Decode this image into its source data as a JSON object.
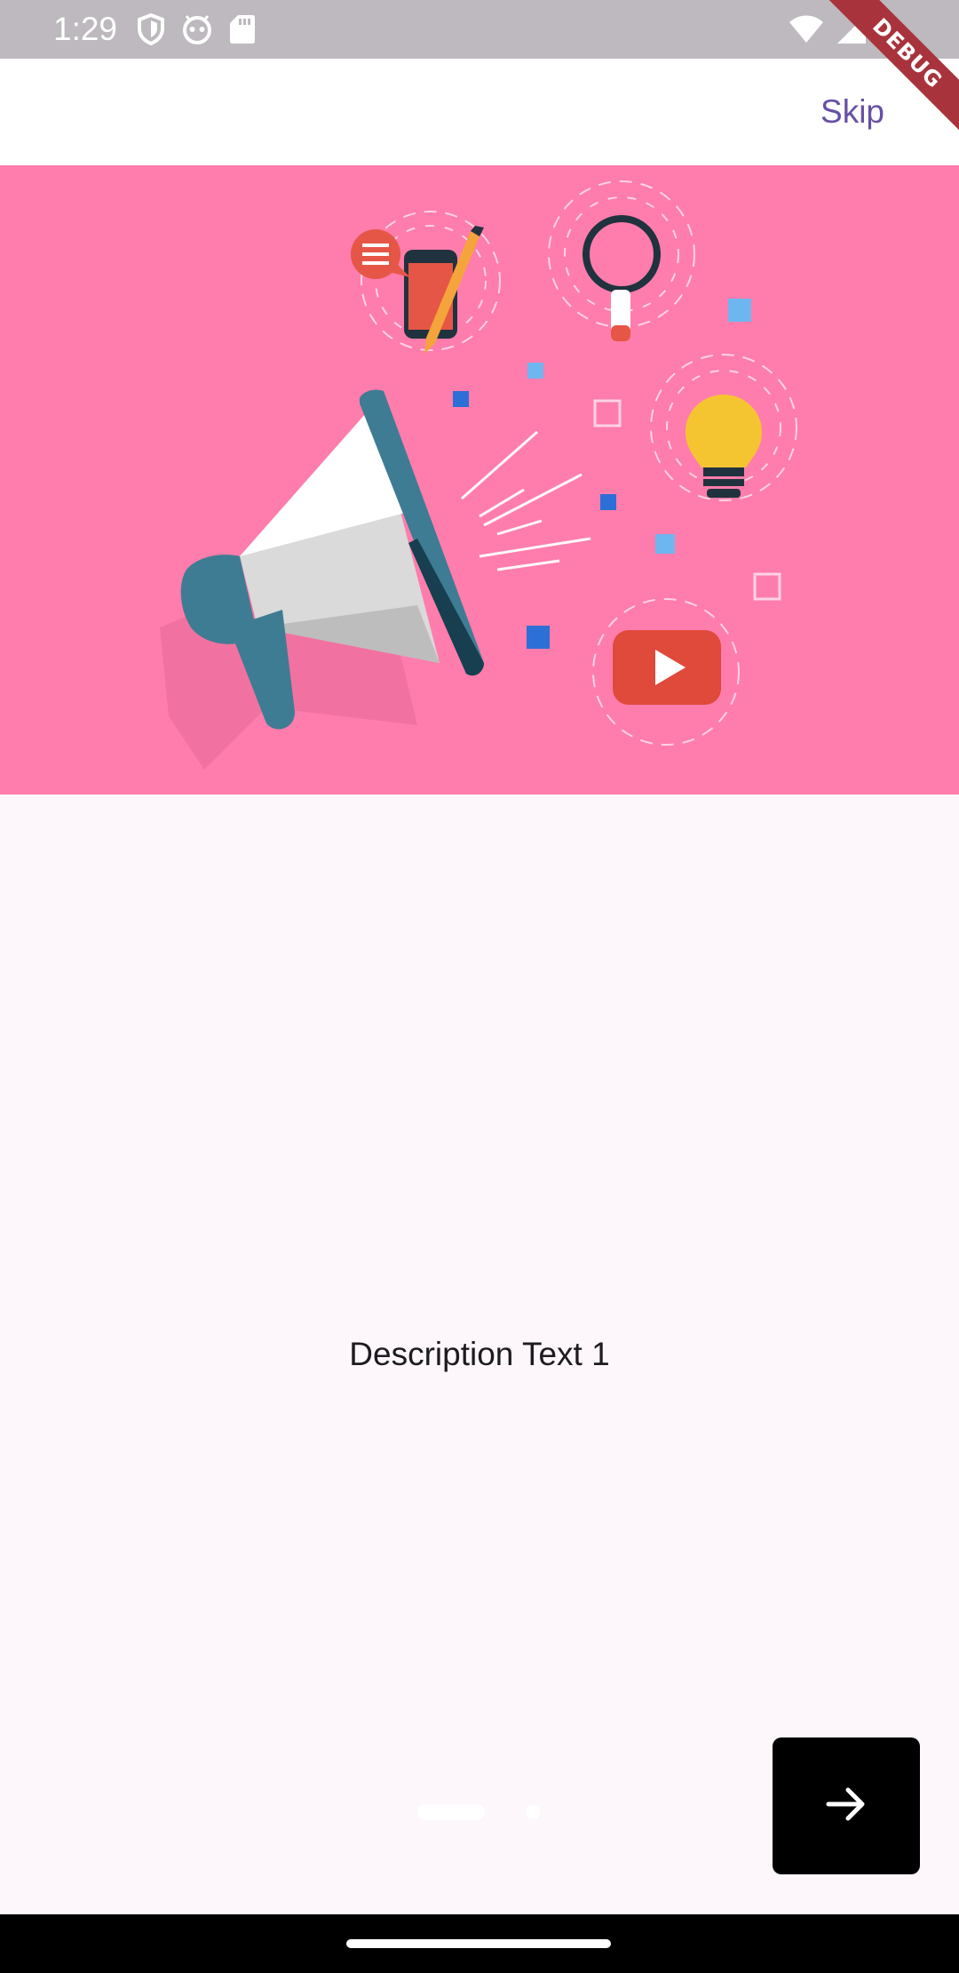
{
  "status_bar": {
    "time": "1:29",
    "left_icons": [
      "shield-icon",
      "android-face-icon",
      "sd-card-icon"
    ],
    "right_icons": [
      "wifi-icon",
      "cellular-signal-icon",
      "battery-icon"
    ],
    "background": "#BDB9BE"
  },
  "debug_banner": {
    "label": "DEBUG"
  },
  "app_bar": {
    "skip_label": "Skip",
    "skip_color": "#6750A4"
  },
  "hero": {
    "illustration": "megaphone-marketing-illustration",
    "background": "#FF7DAC"
  },
  "content": {
    "description": "Description Text 1"
  },
  "page_indicator": {
    "current_page": 1,
    "total_pages": 2
  },
  "next_button": {
    "icon": "arrow-right-icon"
  },
  "colors": {
    "page_background": "#FDF7FB",
    "accent": "#6750A4"
  }
}
